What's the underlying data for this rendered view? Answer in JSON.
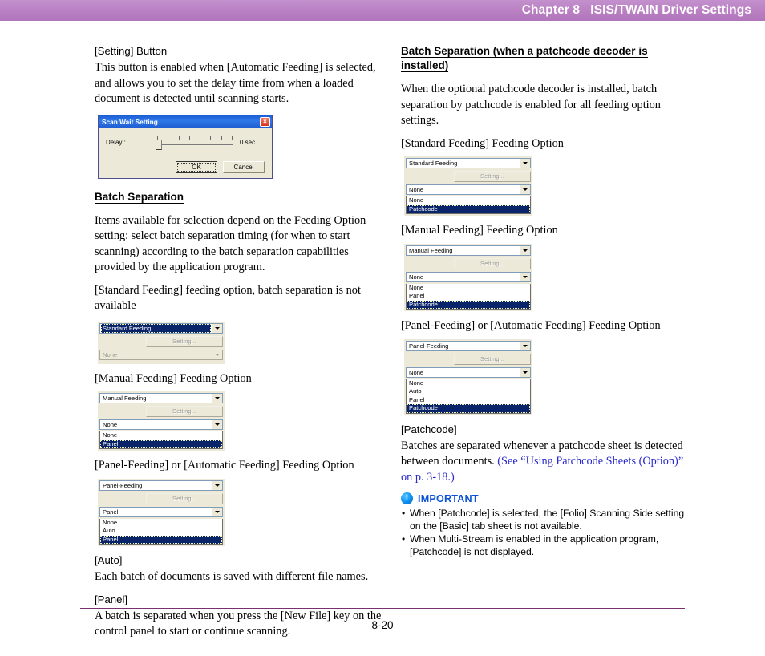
{
  "header": {
    "chapter": "Chapter 8",
    "title": "ISIS/TWAIN Driver Settings",
    "full": "Chapter 8   ISIS/TWAIN Driver Settings",
    "bar_color": "#b77ec0"
  },
  "footer": {
    "page_number": "8-20",
    "rule_color": "#7a2f6f"
  },
  "left_column": {
    "setting_button": {
      "heading": "[Setting] Button",
      "body": "This button is enabled when [Automatic Feeding] is selected, and allows you to set the delay time from when a loaded document is detected until scanning starts."
    },
    "scan_wait_dialog": {
      "title": "Scan Wait Setting",
      "close_label": "×",
      "delay_label": "Delay :",
      "delay_value": "0 sec",
      "ok_label": "OK",
      "cancel_label": "Cancel"
    },
    "batch_separation": {
      "heading": "Batch Separation",
      "body": "Items available for selection depend on the Feeding Option setting: select batch separation timing (for when to start scanning) according to the batch separation capabilities provided by the application program.",
      "note": "[Standard Feeding] feeding option, batch separation is not available"
    },
    "widget_standard": {
      "feeding_option": "Standard Feeding",
      "setting_label": "Setting...",
      "separation_value": "None",
      "options": []
    },
    "caption_manual": "[Manual Feeding] Feeding Option",
    "widget_manual": {
      "feeding_option": "Manual Feeding",
      "setting_label": "Setting...",
      "separation_value": "None",
      "options": [
        "None",
        "Panel"
      ],
      "highlighted": "Panel"
    },
    "caption_panel": "[Panel-Feeding] or [Automatic Feeding] Feeding Option",
    "widget_panel": {
      "feeding_option": "Panel-Feeding",
      "setting_label": "Setting...",
      "separation_value": "Panel",
      "options": [
        "None",
        "Auto",
        "Panel"
      ],
      "highlighted": "Panel"
    },
    "auto": {
      "heading": "[Auto]",
      "body": "Each batch of documents is saved with different file names."
    },
    "panel": {
      "heading": "[Panel]",
      "body": "A batch is separated when you press the [New File] key on the control panel to start or continue scanning."
    }
  },
  "right_column": {
    "batch_separation_patchcode": {
      "heading": "Batch Separation (when a patchcode decoder is installed)",
      "body": "When the optional patchcode decoder is installed, batch separation by patchcode is enabled for all feeding option settings."
    },
    "caption_standard": "[Standard Feeding] Feeding Option",
    "widget_standard": {
      "feeding_option": "Standard Feeding",
      "setting_label": "Setting...",
      "separation_value": "None",
      "options": [
        "None",
        "Patchcode"
      ],
      "highlighted": "Patchcode"
    },
    "caption_manual": "[Manual Feeding] Feeding Option",
    "widget_manual": {
      "feeding_option": "Manual Feeding",
      "setting_label": "Setting...",
      "separation_value": "None",
      "options": [
        "None",
        "Panel",
        "Patchcode"
      ],
      "highlighted": "Patchcode"
    },
    "caption_panel": "[Panel-Feeding] or [Automatic Feeding] Feeding Option",
    "widget_panel": {
      "feeding_option": "Panel-Feeding",
      "setting_label": "Setting...",
      "separation_value": "None",
      "options": [
        "None",
        "Auto",
        "Panel",
        "Patchcode"
      ],
      "highlighted": "Patchcode"
    },
    "patchcode": {
      "heading": "[Patchcode]",
      "body_plain": "Batches are separated whenever a patchcode sheet is detected between documents. ",
      "body_link": "(See “Using Patchcode Sheets (Option)” on p. 3-18.)",
      "link_color": "#2a2ad0"
    },
    "important": {
      "label": "IMPORTANT",
      "icon": "exclamation-circle-icon",
      "color": "#0a53d8",
      "items": [
        "When [Patchcode] is selected, the [Folio] Scanning Side setting on the [Basic] tab sheet is not available.",
        "When Multi-Stream is enabled in the application program, [Patchcode] is not displayed."
      ]
    }
  }
}
